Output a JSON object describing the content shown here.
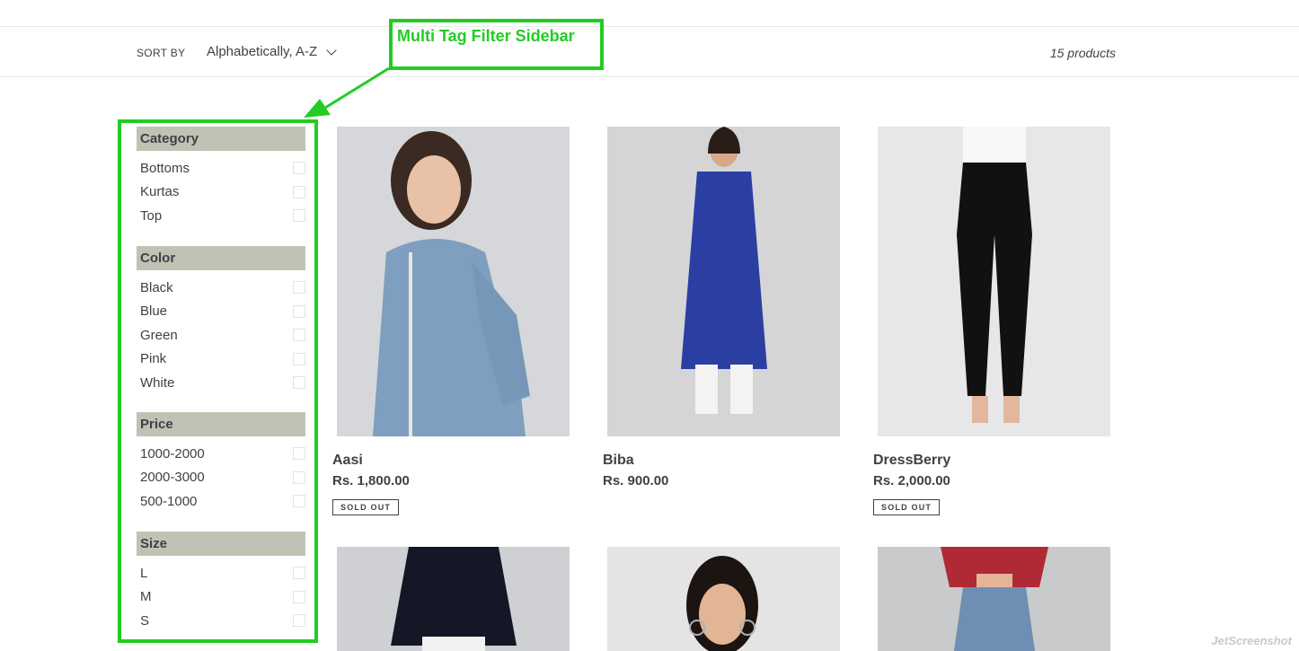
{
  "toolbar": {
    "sort_label": "SORT BY",
    "sort_value": "Alphabetically, A-Z",
    "product_count": "15 products"
  },
  "annotation": {
    "text": "Multi Tag Filter Sidebar",
    "color": "#22cc22"
  },
  "filters": [
    {
      "title": "Category",
      "options": [
        "Bottoms",
        "Kurtas",
        "Top"
      ]
    },
    {
      "title": "Color",
      "options": [
        "Black",
        "Blue",
        "Green",
        "Pink",
        "White"
      ]
    },
    {
      "title": "Price",
      "options": [
        "1000-2000",
        "2000-3000",
        "500-1000"
      ]
    },
    {
      "title": "Size",
      "options": [
        "L",
        "M",
        "S"
      ]
    }
  ],
  "products": [
    {
      "name": "Aasi",
      "price": "Rs. 1,800.00",
      "badge": "SOLD OUT"
    },
    {
      "name": "Biba",
      "price": "Rs. 900.00",
      "badge": ""
    },
    {
      "name": "DressBerry",
      "price": "Rs. 2,000.00",
      "badge": "SOLD OUT"
    }
  ],
  "watermark": "JetScreenshot",
  "colors": {
    "filter_header_bg": "#c0c2b4",
    "text": "#3d4246",
    "annotation": "#22cc22"
  }
}
